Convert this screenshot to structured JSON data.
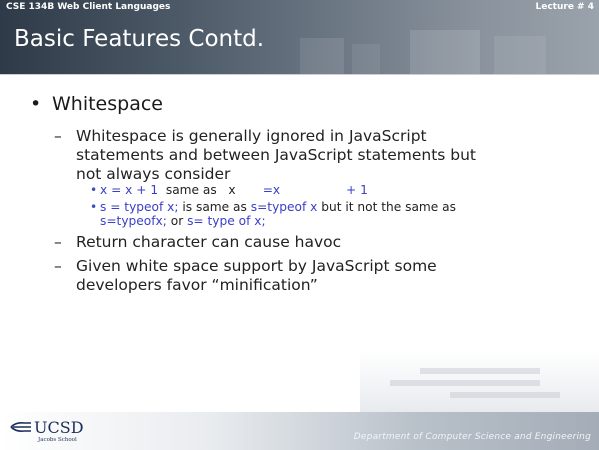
{
  "header": {
    "course": "CSE 134B  Web Client Languages",
    "lecture": "Lecture # 4",
    "title": "Basic Features Contd."
  },
  "body": {
    "bullet_glyph": "•",
    "dash_glyph": "–",
    "point": "Whitespace",
    "sub1_lines": [
      "Whitespace is generally ignored in JavaScript",
      "statements and between JavaScript statements but",
      "not always consider"
    ],
    "ex1": {
      "code_a": "x = x + 1",
      "mid": "  same as   x",
      "code_b": "       =x                 + 1"
    },
    "ex2": {
      "code_a": "s = typeof x;",
      "mid_a": " is same as ",
      "code_b": "s=typeof x",
      "mid_b": " but it not the same as",
      "code_c": "s=typeofx;",
      "mid_c": " or ",
      "code_d": "s= type of x;"
    },
    "sub2": "Return character can cause havoc",
    "sub3_lines": [
      "Given white space support by JavaScript some",
      "developers favor “minification”"
    ]
  },
  "footer": {
    "logo_name": "UCSD",
    "logo_sub": "Jacobs School",
    "department": "Department of Computer Science and Engineering"
  },
  "colors": {
    "code_blue": "#3a3ec8",
    "header_dark": "#2f3a48",
    "logo_navy": "#1b2d5b"
  }
}
